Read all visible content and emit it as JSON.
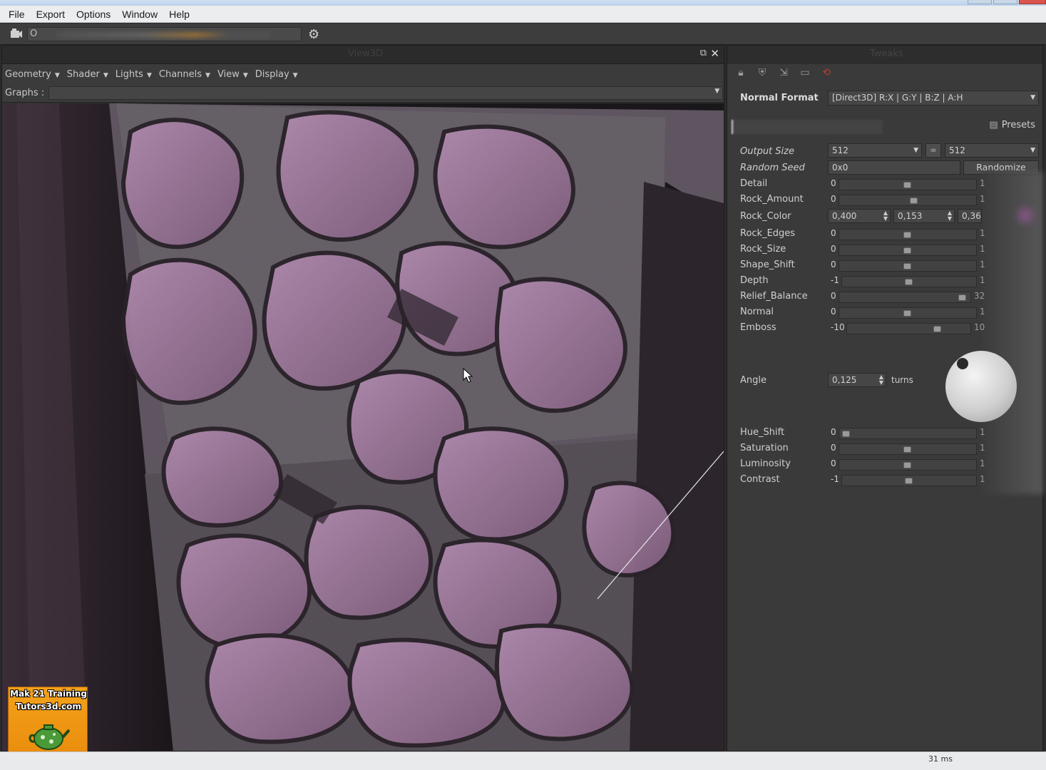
{
  "menubar": {
    "items": [
      "File",
      "Export",
      "Options",
      "Window",
      "Help"
    ]
  },
  "toolbar": {
    "field_prefix": "O",
    "camera_icon": "camera-icon",
    "settings_icon": "gear-icon"
  },
  "viewport": {
    "title": "View3D",
    "menus": [
      "Geometry",
      "Shader",
      "Lights",
      "Channels",
      "View",
      "Display"
    ],
    "graphs_label": "Graphs :"
  },
  "tweaks": {
    "title": "Tweaks",
    "normal_format_label": "Normal Format",
    "normal_format_value": "[Direct3D] R:X | G:Y | B:Z | A:H",
    "presets_label": "Presets",
    "output_size_label": "Output Size",
    "output_size_w": "512",
    "output_size_h": "512",
    "random_seed_label": "Random Seed",
    "random_seed_value": "0x0",
    "randomize_label": "Randomize",
    "rock_color_label": "Rock_Color",
    "rock_color_values": [
      "0,400",
      "0,153",
      "0,36"
    ],
    "angle_label": "Angle",
    "angle_value": "0,125",
    "angle_unit": "turns",
    "sliders": [
      {
        "label": "Detail",
        "min": "0",
        "max": "1",
        "pos": 0.5
      },
      {
        "label": "Rock_Amount",
        "min": "0",
        "max": "1",
        "pos": 0.55
      },
      {
        "label": "Rock_Edges",
        "min": "0",
        "max": "1",
        "pos": 0.5
      },
      {
        "label": "Rock_Size",
        "min": "0",
        "max": "1",
        "pos": 0.5
      },
      {
        "label": "Shape_Shift",
        "min": "0",
        "max": "1",
        "pos": 0.5
      },
      {
        "label": "Depth",
        "min": "-1",
        "max": "1",
        "pos": 0.5
      },
      {
        "label": "Relief_Balance",
        "min": "0",
        "max": "32",
        "pos": 0.97
      },
      {
        "label": "Normal",
        "min": "0",
        "max": "1",
        "pos": 0.5
      },
      {
        "label": "Emboss",
        "min": "-10",
        "max": "10",
        "pos": 0.75
      }
    ],
    "sliders2": [
      {
        "label": "Hue_Shift",
        "min": "0",
        "max": "1",
        "pos": 0.02
      },
      {
        "label": "Saturation",
        "min": "0",
        "max": "1",
        "pos": 0.5
      },
      {
        "label": "Luminosity",
        "min": "0",
        "max": "1",
        "pos": 0.5
      },
      {
        "label": "Contrast",
        "min": "-1",
        "max": "1",
        "pos": 0.5
      }
    ]
  },
  "status": {
    "timing": "31 ms"
  },
  "watermark": {
    "line1": "Mak 21 Training",
    "line2": "Tutors3d.com"
  }
}
